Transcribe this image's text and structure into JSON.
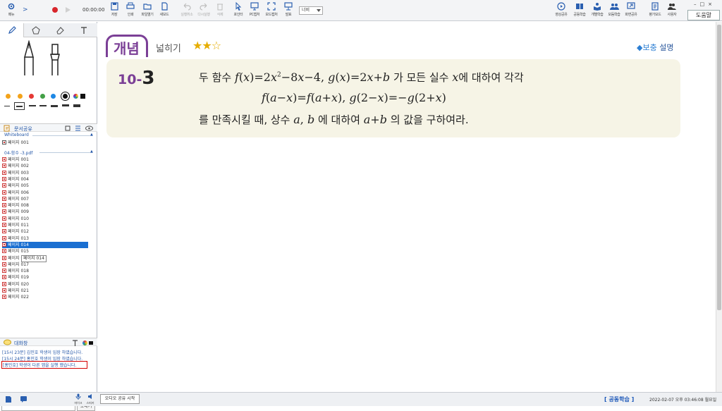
{
  "toolbar": {
    "menu_label": "메뉴",
    "time": "00:00:00",
    "buttons": [
      {
        "id": "save",
        "label": "저장",
        "enabled": true
      },
      {
        "id": "print",
        "label": "인쇄",
        "enabled": true
      },
      {
        "id": "open",
        "label": "파일열기",
        "enabled": true
      },
      {
        "id": "new",
        "label": "새보드",
        "enabled": true
      },
      {
        "id": "undo",
        "label": "실행취소",
        "enabled": false
      },
      {
        "id": "redo",
        "label": "다시실행",
        "enabled": false
      },
      {
        "id": "delete",
        "label": "삭제",
        "enabled": false
      },
      {
        "id": "pointer",
        "label": "포인터",
        "enabled": true
      },
      {
        "id": "pc-capture",
        "label": "PC캡처",
        "enabled": true
      },
      {
        "id": "board-capture",
        "label": "보드캡처",
        "enabled": true
      },
      {
        "id": "present",
        "label": "발표",
        "enabled": true
      }
    ],
    "zoom_value": "너비",
    "right_buttons": [
      {
        "id": "video-share",
        "label": "영상공유"
      },
      {
        "id": "coop-learn",
        "label": "공동학습"
      },
      {
        "id": "individual-learn",
        "label": "개별학습"
      },
      {
        "id": "group-learn",
        "label": "모둠학습"
      },
      {
        "id": "screen-share",
        "label": "화면공유"
      },
      {
        "id": "eval-mode",
        "label": "평가모드"
      },
      {
        "id": "users",
        "label": "사용자"
      }
    ],
    "help_label": "도움말"
  },
  "left_panel": {
    "doc_share_title": "문서공유",
    "whiteboard_group": "Whiteboard",
    "whiteboard_pages": [
      "페이지 001"
    ],
    "pdf_group": "04-함수 -3.pdf",
    "pdf_pages": [
      "페이지 001",
      "페이지 002",
      "페이지 003",
      "페이지 004",
      "페이지 005",
      "페이지 006",
      "페이지 007",
      "페이지 008",
      "페이지 009",
      "페이지 010",
      "페이지 011",
      "페이지 012",
      "페이지 013",
      "페이지 014",
      "페이지 015",
      "페이지 016",
      "페이지 017",
      "페이지 018",
      "페이지 019",
      "페이지 020",
      "페이지 021",
      "페이지 022"
    ],
    "selected_page": "페이지 014",
    "tooltip": "페이지 014",
    "chat_title": "대화창",
    "chat_messages": [
      "[15시 23분] 김민호 학생이 입장 하였습니다.",
      "[15시 24분] 홍민호 학생이 입장 하였습니다.",
      "[홍민호] 학생이 다른 앱을 실행 했습니다."
    ],
    "send_label": "보내기",
    "mic_label": "마이크",
    "speaker_label": "스피커"
  },
  "colors": {
    "accent": "#7b3f96",
    "link": "#2457a8",
    "alert": "#d40000",
    "selection": "#1a6fd1",
    "star": "#e6ad00",
    "problem_bg": "#f6f4e6"
  },
  "content": {
    "concept_label": "개념",
    "level_label": "넓히기",
    "stars": "★★☆",
    "supplement_prefix": "◆보충",
    "supplement_suffix": " 설명",
    "problem_number_prefix": "10-",
    "problem_number_main": "3"
  },
  "bottom_bar": {
    "audio_share": "오디오 공유 시작",
    "coop_status": "[ 공동학습 ]",
    "datetime": "2022-02-07 오후 03:46:08 월요일"
  }
}
